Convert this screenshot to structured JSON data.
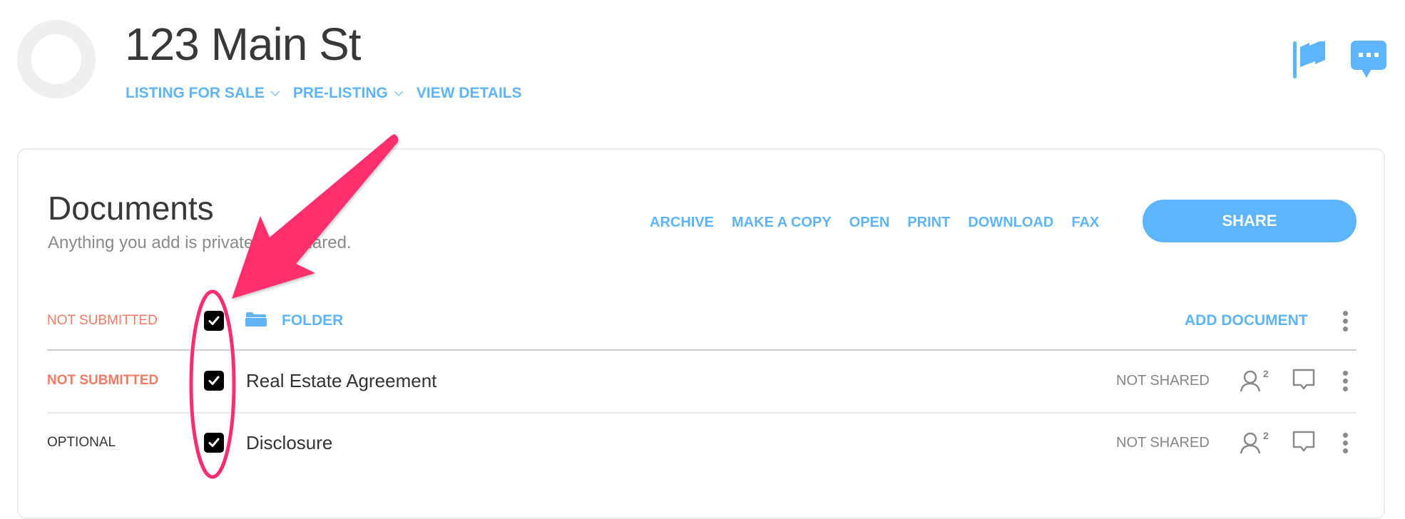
{
  "header": {
    "title": "123 Main St",
    "nav": [
      {
        "label": "LISTING FOR SALE",
        "has_dropdown": true
      },
      {
        "label": "PRE-LISTING",
        "has_dropdown": true
      },
      {
        "label": "VIEW DETAILS",
        "has_dropdown": false
      }
    ],
    "icons": [
      "flag-icon",
      "chat-bubble-icon"
    ]
  },
  "documents": {
    "title": "Documents",
    "subtitle": "Anything you add is private until shared.",
    "actions": [
      "ARCHIVE",
      "MAKE A COPY",
      "OPEN",
      "PRINT",
      "DOWNLOAD",
      "FAX"
    ],
    "share_label": "SHARE",
    "folder_row": {
      "status": "NOT SUBMITTED",
      "checked": true,
      "label": "FOLDER",
      "add_label": "ADD DOCUMENT"
    },
    "rows": [
      {
        "status": "NOT SUBMITTED",
        "checked": true,
        "name": "Real Estate Agreement",
        "share_state": "NOT SHARED",
        "people_count": "2"
      },
      {
        "status": "OPTIONAL",
        "checked": true,
        "name": "Disclosure",
        "share_state": "NOT SHARED",
        "people_count": "2"
      }
    ]
  },
  "annotation": {
    "type": "arrow-and-ellipse",
    "target": "row checkboxes",
    "color": "#ff2d6d"
  },
  "colors": {
    "accent": "#5eb4f6",
    "warning": "#f57a62",
    "text": "#383838",
    "muted": "#858585"
  }
}
